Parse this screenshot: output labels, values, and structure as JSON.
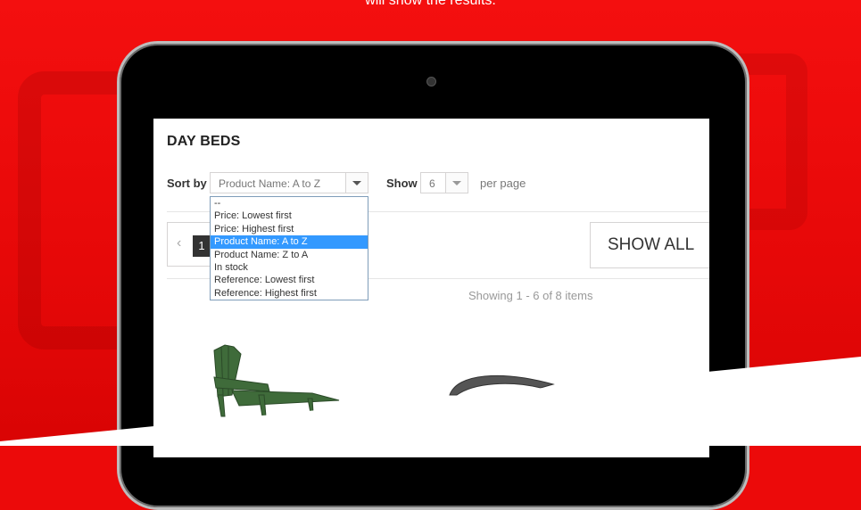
{
  "banner": {
    "text": "will show the results."
  },
  "page": {
    "title": "DAY BEDS"
  },
  "sort": {
    "label": "Sort by",
    "selected": "Product Name: A to Z",
    "options": [
      "--",
      "Price: Lowest first",
      "Price: Highest first",
      "Product Name: A to Z",
      "Product Name: Z to A",
      "In stock",
      "Reference: Lowest first",
      "Reference: Highest first"
    ],
    "selected_index": 3
  },
  "show": {
    "label": "Show",
    "value": "6",
    "suffix": "per page"
  },
  "pagination": {
    "prev_icon": "chevron-left-icon",
    "current": "1"
  },
  "show_all": {
    "label": "SHOW ALL"
  },
  "results": {
    "text": "Showing 1 - 6 of 8 items"
  },
  "colors": {
    "brand_red": "#ec0a0a",
    "highlight": "#3399ff",
    "text_dark": "#333333"
  }
}
